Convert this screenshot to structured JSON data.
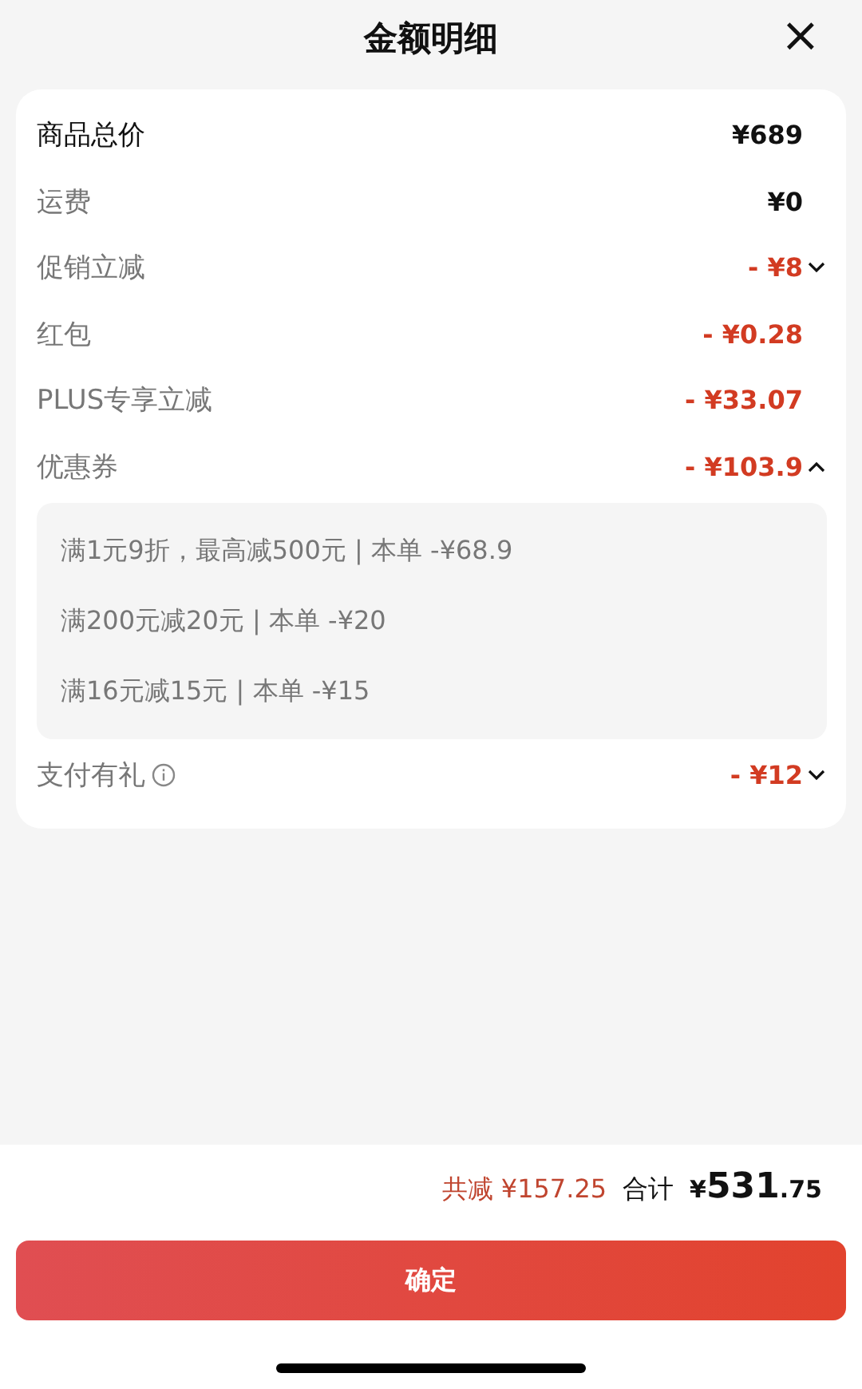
{
  "header": {
    "title": "金额明细",
    "close": "×"
  },
  "rows": [
    {
      "kind": "total",
      "label": "商品总价",
      "amount": "¥689"
    },
    {
      "kind": "fee",
      "label": "运费",
      "amount": "¥0"
    },
    {
      "kind": "discount",
      "label": "促销立减",
      "amount": "- ¥8",
      "expanded": false
    },
    {
      "kind": "discount",
      "label": "红包",
      "amount": "- ¥0.28"
    },
    {
      "kind": "discount",
      "label": "PLUS专享立减",
      "amount": "- ¥33.07"
    },
    {
      "kind": "discount",
      "label": "优惠券",
      "amount": "- ¥103.9",
      "expanded": true,
      "details": [
        "满1元9折，最高减500元 | 本单 -¥68.9",
        "满200元减20元 | 本单 -¥20",
        "满16元减15元 | 本单 -¥15"
      ]
    },
    {
      "kind": "discount",
      "label": "支付有礼",
      "amount": "- ¥12",
      "expanded": false,
      "info": true
    }
  ],
  "summary": {
    "saved": "共减 ¥157.25",
    "total_label": "合计",
    "total_currency": "¥",
    "total_integer": "531",
    "total_decimal": ".75"
  },
  "confirm_button": "确定"
}
